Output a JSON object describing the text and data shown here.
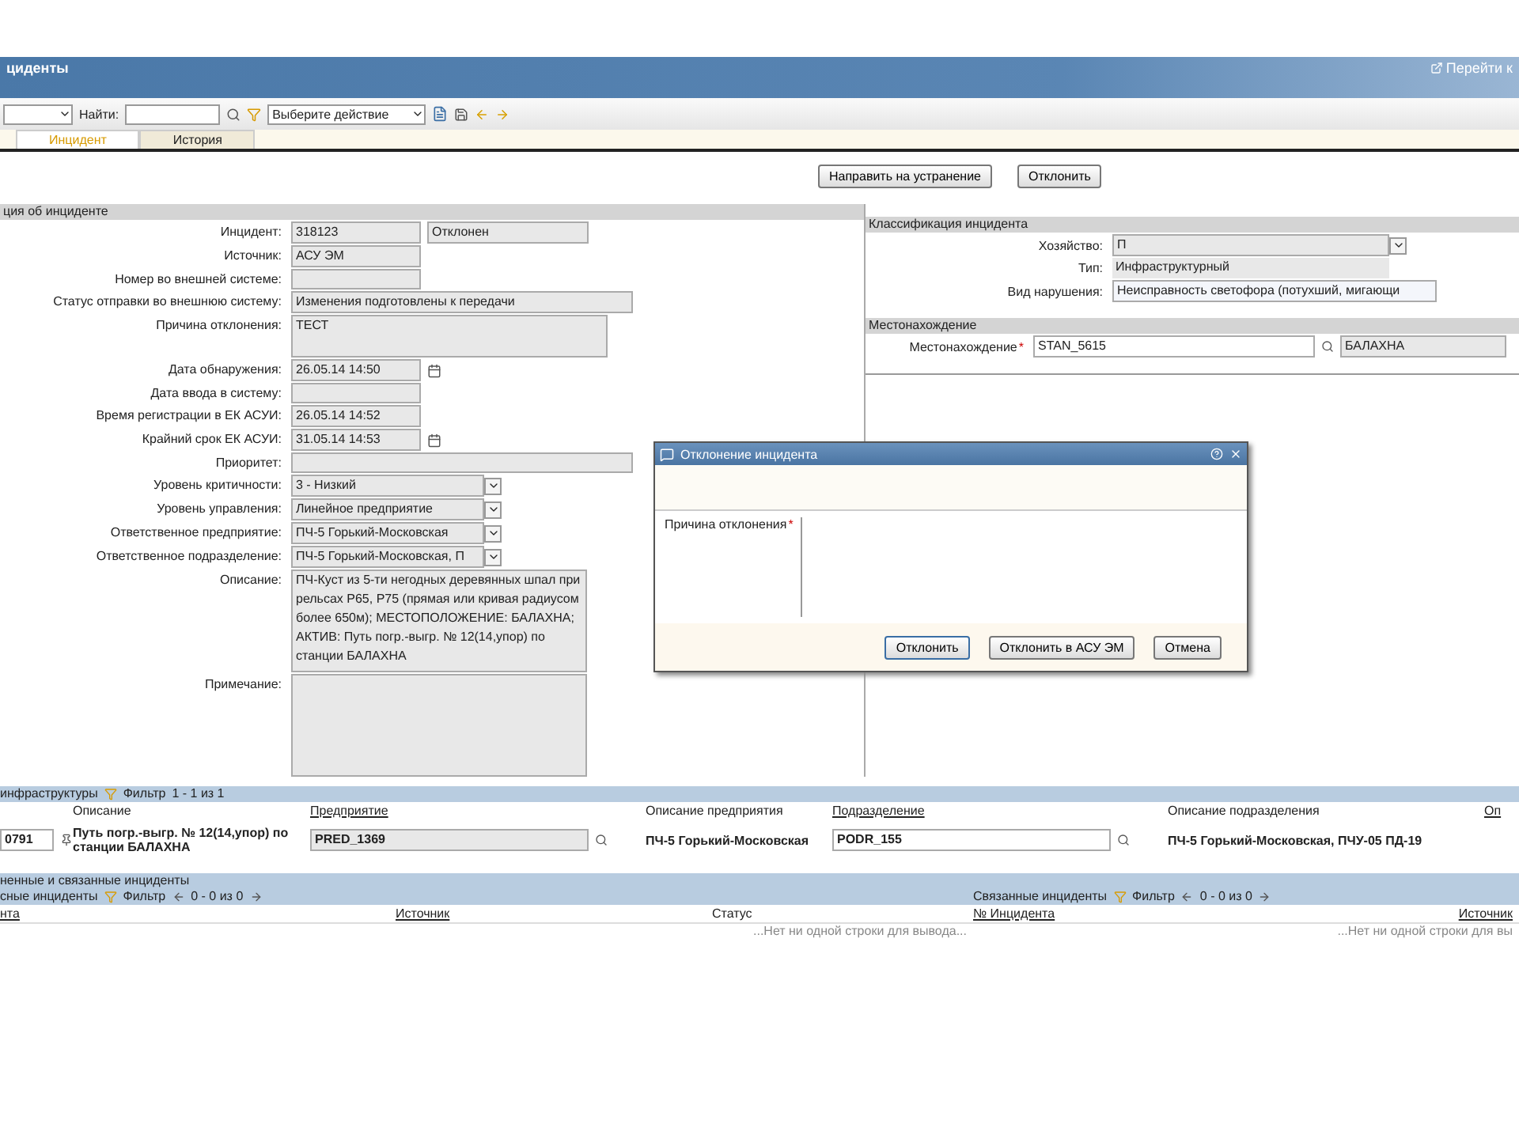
{
  "header": {
    "title": "циденты",
    "link": "Перейти к"
  },
  "toolbar": {
    "find_label": "Найти:",
    "action_select": "Выберите действие"
  },
  "tabs": [
    {
      "label": "Инцидент",
      "selected": true
    },
    {
      "label": "История",
      "selected": false
    }
  ],
  "actions": [
    "Направить на устранение",
    "Отклонить"
  ],
  "info": {
    "title": "ция об инциденте",
    "fields": [
      {
        "kind": "short",
        "label": "Инцидент:",
        "value": "318123",
        "extra": "Отклонен"
      },
      {
        "kind": "short",
        "label": "Источник:",
        "value": "АСУ ЭМ"
      },
      {
        "kind": "short",
        "label": "Номер во внешней системе:"
      },
      {
        "kind": "long",
        "label": "Статус отправки во внешнюю систему:",
        "value": "Изменения подготовлены к передачи"
      },
      {
        "kind": "area",
        "label": "Причина отклонения:",
        "value": "ТЕСТ"
      },
      {
        "kind": "date",
        "label": "Дата обнаружения:",
        "value": "26.05.14 14:50"
      },
      {
        "kind": "short",
        "label": "Дата ввода в систему:"
      },
      {
        "kind": "short",
        "label": "Время регистрации в ЕК АСУИ:",
        "value": "26.05.14 14:52"
      },
      {
        "kind": "date",
        "label": "Крайний срок ЕК АСУИ:",
        "value": "31.05.14 14:53"
      },
      {
        "kind": "long",
        "label": "Приоритет:"
      },
      {
        "kind": "select",
        "label": "Уровень критичности:",
        "value": "3 - Низкий"
      },
      {
        "kind": "select",
        "label": "Уровень управления:",
        "value": "Линейное предприятие"
      },
      {
        "kind": "select",
        "label": "Ответственное предприятие:",
        "value": "ПЧ-5 Горький-Московская"
      },
      {
        "kind": "select",
        "label": "Ответственное подразделение:",
        "value": "ПЧ-5 Горький-Московская, П"
      },
      {
        "kind": "bigarea",
        "label": "Описание:",
        "value": "ПЧ-Куст из 5-ти негодных деревянных шпал при рельсах Р65, Р75 (прямая или кривая радиусом более 650м); МЕСТОПОЛОЖЕНИЕ: БАЛАХНА; АКТИВ: Путь погр.-выгр. № 12(14,упор) по станции БАЛАХНА"
      },
      {
        "kind": "bigarea",
        "label": "Примечание:"
      }
    ]
  },
  "classification": {
    "title": "Классификация инцидента",
    "fields": [
      {
        "kind": "select",
        "label": "Хозяйство:",
        "value": "П"
      },
      {
        "kind": "plain",
        "label": "Тип:",
        "value": "Инфраструктурный"
      },
      {
        "kind": "input",
        "label": "Вид нарушения:",
        "value": "Неисправность светофора (потухший, мигающи"
      }
    ]
  },
  "location": {
    "title": "Местонахождение",
    "label": "Местонахождение",
    "required_mark": "*",
    "code": "STAN_5615",
    "name": "БАЛАХНА"
  },
  "dialog": {
    "title": "Отклонение инцидента",
    "label": "Причина отклонения",
    "required_mark": "*",
    "buttons": [
      {
        "label": "Отклонить",
        "selected": true
      },
      {
        "label": "Отклонить в АСУ ЭМ",
        "selected": false
      },
      {
        "label": "Отмена",
        "selected": false
      }
    ]
  },
  "infra": {
    "title": "инфраструктуры",
    "filter": "Фильтр",
    "pager": "1 - 1 из 1",
    "columns": [
      {
        "label": "Описание",
        "link": false
      },
      {
        "label": "Предприятие",
        "link": true
      },
      {
        "label": "Описание предприятия",
        "link": false
      },
      {
        "label": "Подразделение",
        "link": true
      },
      {
        "label": "Описание подразделения",
        "link": false
      },
      {
        "label": "Оп",
        "link": true
      }
    ],
    "row": {
      "id": "0791",
      "description": "Путь погр.-выгр. № 12(14,упор) по станции БАЛАХНА",
      "enterprise": "PRED_1369",
      "enterprise_desc": "ПЧ-5 Горький-Московская",
      "unit": "PODR_155",
      "unit_desc": "ПЧ-5 Горький-Московская, ПЧУ-05 ПД-19"
    }
  },
  "related": {
    "title": "ненные и связанные инциденты",
    "panes": [
      {
        "title": "сные инциденты",
        "filter": "Фильтр",
        "pager": "0 - 0 из 0",
        "columns": [
          "нта",
          "Источник",
          "Статус"
        ],
        "empty": "...Нет ни одной строки для вывода..."
      },
      {
        "title": "Связанные инциденты",
        "filter": "Фильтр",
        "pager": "0 - 0 из 0",
        "columns": [
          "№ Инцидента",
          "Источник"
        ],
        "empty": "...Нет ни одной строки для вы"
      }
    ]
  }
}
